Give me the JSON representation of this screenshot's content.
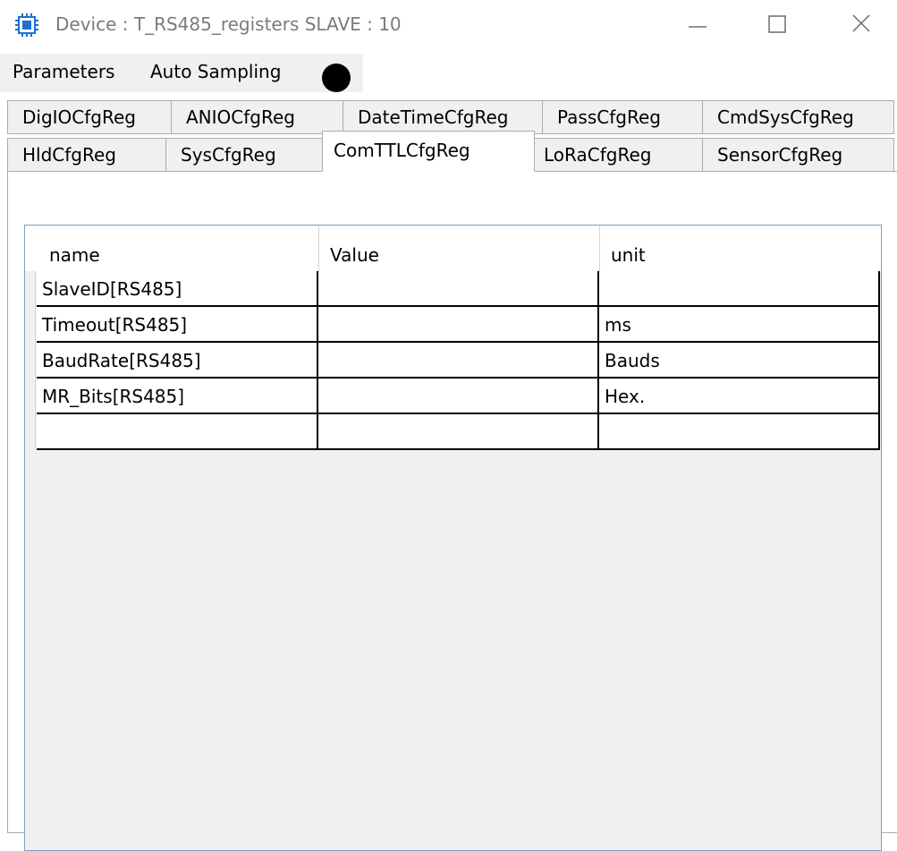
{
  "window": {
    "title": "Device : T_RS485_registers SLAVE : 10",
    "icon": "chip-icon",
    "controls": [
      "minimize-icon",
      "maximize-icon",
      "close-icon"
    ]
  },
  "menu": {
    "items": [
      "Parameters",
      "Auto Sampling"
    ],
    "status_indicator_color": "#000000"
  },
  "tabs": {
    "row_top": [
      "DigIOCfgReg",
      "ANIOCfgReg",
      "DateTimeCfgReg",
      "PassCfgReg",
      "CmdSysCfgReg"
    ],
    "row_bottom": [
      "HldCfgReg",
      "SysCfgReg",
      "ComTTLCfgReg",
      "LoRaCfgReg",
      "SensorCfgReg"
    ],
    "selected": "ComTTLCfgReg"
  },
  "grid": {
    "columns": [
      "name",
      "Value",
      "unit"
    ],
    "rows": [
      {
        "name": "SlaveID[RS485]",
        "value": "",
        "unit": ""
      },
      {
        "name": "Timeout[RS485]",
        "value": "",
        "unit": "ms"
      },
      {
        "name": "BaudRate[RS485]",
        "value": "",
        "unit": "Bauds"
      },
      {
        "name": "MR_Bits[RS485]",
        "value": "",
        "unit": "Hex."
      },
      {
        "name": "",
        "value": "",
        "unit": ""
      }
    ],
    "border_color": "#7e9fc3"
  }
}
